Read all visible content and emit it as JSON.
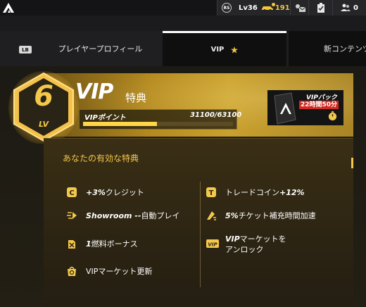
{
  "topbar": {
    "rs_badge": "RS",
    "level": "Lv36",
    "currency_value": "191",
    "friends_count": "0"
  },
  "tabs": {
    "lb_badge": "LB",
    "items": [
      {
        "label": "プレイヤープロフィール"
      },
      {
        "label": "VIP"
      },
      {
        "label": "新コンテンツ"
      }
    ]
  },
  "vip_header": {
    "level": "6",
    "level_unit": "LV",
    "title": "VIP",
    "subtitle": "特典",
    "points_label": "VIPポイント",
    "points_value": "31100/63100",
    "points_current": 31100,
    "points_max": 63100
  },
  "pack": {
    "title": "VIPパック",
    "time": "22時間50分"
  },
  "benefits": {
    "title": "あなたの有効な特典",
    "left": [
      {
        "icon": "credit-coin-icon",
        "bold": "+3%",
        "text": " クレジット"
      },
      {
        "icon": "autoplay-icon",
        "bold": "Showroom -- ",
        "text": "自動プレイ"
      },
      {
        "icon": "fuel-can-icon",
        "bold": "1 ",
        "text": "燃料ボーナス"
      },
      {
        "icon": "market-refresh-icon",
        "bold": "",
        "text": "VIPマーケット更新"
      }
    ],
    "right": [
      {
        "icon": "trade-coin-icon",
        "text": "トレードコイン",
        "bold": "+12%"
      },
      {
        "icon": "ticket-speed-icon",
        "bold": "5%",
        "text": " チケット補充時間加速"
      },
      {
        "icon": "vip-market-icon",
        "bold": "VIP",
        "text": "マーケットを",
        "text2": "アンロック"
      }
    ]
  },
  "colors": {
    "accent_gold": "#f4c84a",
    "timer_red": "#d02a20"
  }
}
